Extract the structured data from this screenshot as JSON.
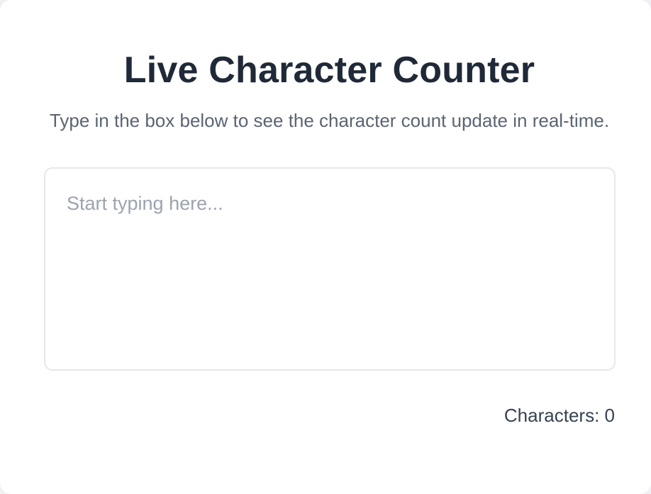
{
  "header": {
    "title": "Live Character Counter",
    "subtitle": "Type in the box below to see the character count update in real-time."
  },
  "input": {
    "value": "",
    "placeholder": "Start typing here..."
  },
  "counter": {
    "label": "Characters:",
    "count": "0"
  }
}
